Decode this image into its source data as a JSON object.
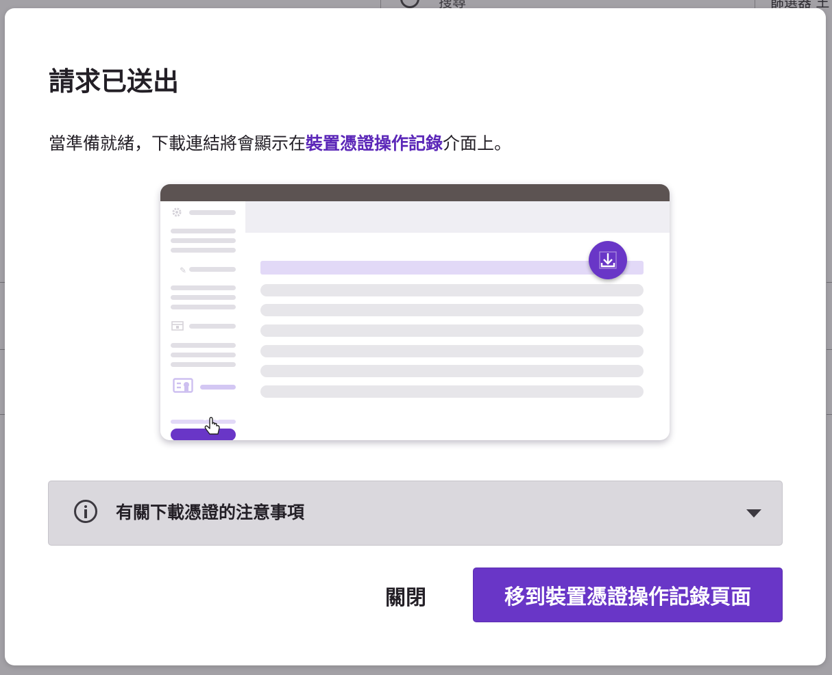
{
  "background": {
    "search_placeholder": "搜尋",
    "filter_label": "篩選器 王"
  },
  "modal": {
    "title": "請求已送出",
    "description_before": "當準備就緒，下載連結將會顯示在",
    "description_link": "裝置憑證操作記錄",
    "description_after": "介面上。",
    "accordion_label": "有關下載憑證的注意事項",
    "close_label": "關閉",
    "primary_label": "移到裝置憑證操作記錄頁面"
  },
  "colors": {
    "accent": "#6936c7",
    "link": "#5b27b8",
    "highlight_row": "#e2d9f7"
  },
  "icons": {
    "download": "download-icon",
    "info": "info-icon",
    "chevron": "chevron-down-icon",
    "cursor": "hand-cursor-icon"
  }
}
